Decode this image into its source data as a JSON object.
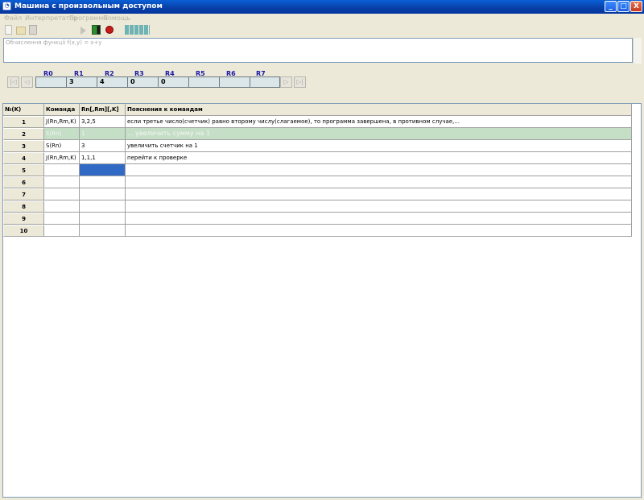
{
  "window": {
    "title": "Машина с произвольным доступом",
    "minimize_glyph": "_",
    "maximize_glyph": "□",
    "close_glyph": "X"
  },
  "menu": [
    "Файл",
    "Интерпретатор",
    "Программа",
    "Помощь"
  ],
  "toolbar": {
    "icons": [
      "new-file-icon",
      "open-folder-icon",
      "save-icon",
      "run-icon",
      "step-icon",
      "stop-icon",
      "speed-bars-icon"
    ]
  },
  "formula": {
    "text": "Обчислення функції  f(x,y) = x+y"
  },
  "registers": {
    "names": [
      "R0",
      "R1",
      "R2",
      "R3",
      "R4",
      "R5",
      "R6",
      "R7"
    ],
    "values": [
      "",
      "3",
      "4",
      "0",
      "0",
      "",
      "",
      ""
    ],
    "nav": {
      "first": "|◁",
      "prev": "◁",
      "next": "▷",
      "last": "▷|"
    }
  },
  "table": {
    "headers": [
      "№(K)",
      "Команда",
      "Rn[,Rm][,K]",
      "Пояснения к командам"
    ],
    "rows": [
      {
        "num": "1",
        "cmd": "J(Rn,Rm,K)",
        "args": "3,2,5",
        "exp": "если третье число(счетчик) равно второму числу(слагаемое), то программа завершена, в противном случае,..."
      },
      {
        "num": "2",
        "cmd": "S(Rn)",
        "args": "1",
        "exp": "... увеличить сумму на 1"
      },
      {
        "num": "3",
        "cmd": "S(Rn)",
        "args": "3",
        "exp": "увеличить счетчик на 1"
      },
      {
        "num": "4",
        "cmd": "J(Rn,Rm,K)",
        "args": "1,1,1",
        "exp": "перейти к проверке"
      },
      {
        "num": "5",
        "cmd": "",
        "args": "",
        "exp": ""
      },
      {
        "num": "6",
        "cmd": "",
        "args": "",
        "exp": ""
      },
      {
        "num": "7",
        "cmd": "",
        "args": "",
        "exp": ""
      },
      {
        "num": "8",
        "cmd": "",
        "args": "",
        "exp": ""
      },
      {
        "num": "9",
        "cmd": "",
        "args": "",
        "exp": ""
      },
      {
        "num": "10",
        "cmd": "",
        "args": "",
        "exp": ""
      }
    ]
  },
  "colors": {
    "title_bar": "#0841a8",
    "highlight_row": "#c5dfc7",
    "selected_cell": "#316ac5",
    "register_fill": "#dbe6e8",
    "register_label": "#1a1aa6"
  }
}
